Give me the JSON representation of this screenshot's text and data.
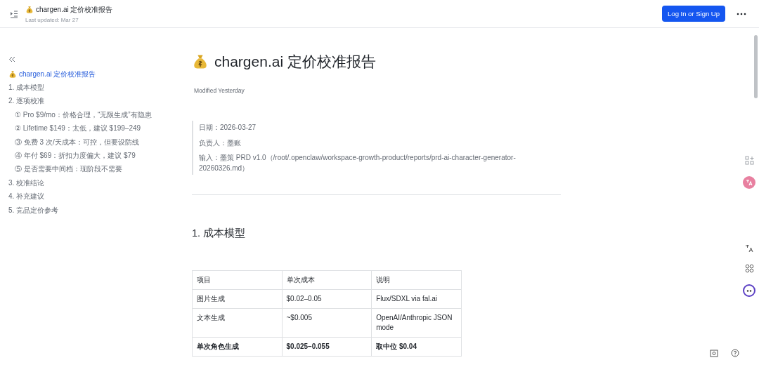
{
  "header": {
    "title": "chargen.ai 定价校准报告",
    "subtitle": "Last updated: Mar 27",
    "login_button": "Log In or Sign Up"
  },
  "outline_title": {
    "label": "chargen.ai 定价校准报告",
    "selected": true
  },
  "outline": [
    {
      "label": "1. 成本模型",
      "selected": false
    },
    {
      "label": "2. 逐项校准",
      "selected": false,
      "children": [
        {
          "label": "① Pro $9/mo：价格合理，“无限生成”有隐患",
          "selected": false
        },
        {
          "label": "② Lifetime $149：太低，建议 $199–249",
          "selected": false
        },
        {
          "label": "③ 免费 3 次/天成本：可控，但要设防线",
          "selected": false
        },
        {
          "label": "④ 年付 $69：折扣力度偏大，建议 $79",
          "selected": false
        },
        {
          "label": "⑤ 是否需要中间档：现阶段不需要",
          "selected": false
        }
      ]
    },
    {
      "label": "3. 校准结论",
      "selected": false
    },
    {
      "label": "4. 补充建议",
      "selected": false
    },
    {
      "label": "5. 竞品定价参考",
      "selected": false
    }
  ],
  "document": {
    "title": "chargen.ai 定价校准报告",
    "modified": "Modified Yesterday",
    "quote": [
      "日期：2026-03-27",
      "负责人：墨账",
      "输入：墨策 PRD v1.0（/root/.openclaw/workspace-growth-product/reports/prd-ai-character-generator-20260326.md）"
    ],
    "heading": "1. 成本模型",
    "table": {
      "columns": [
        "项目",
        "单次成本",
        "说明"
      ],
      "rows": [
        {
          "bold": false,
          "cells": [
            "图片生成",
            "$0.02–0.05",
            "Flux/SDXL via fal.ai"
          ]
        },
        {
          "bold": false,
          "cells": [
            "文本生成",
            "~$0.005",
            "OpenAI/Anthropic JSON mode"
          ]
        },
        {
          "bold": true,
          "cells": [
            "单次角色生成",
            "$0.025–0.055",
            "取中位 $0.04"
          ]
        }
      ]
    }
  }
}
